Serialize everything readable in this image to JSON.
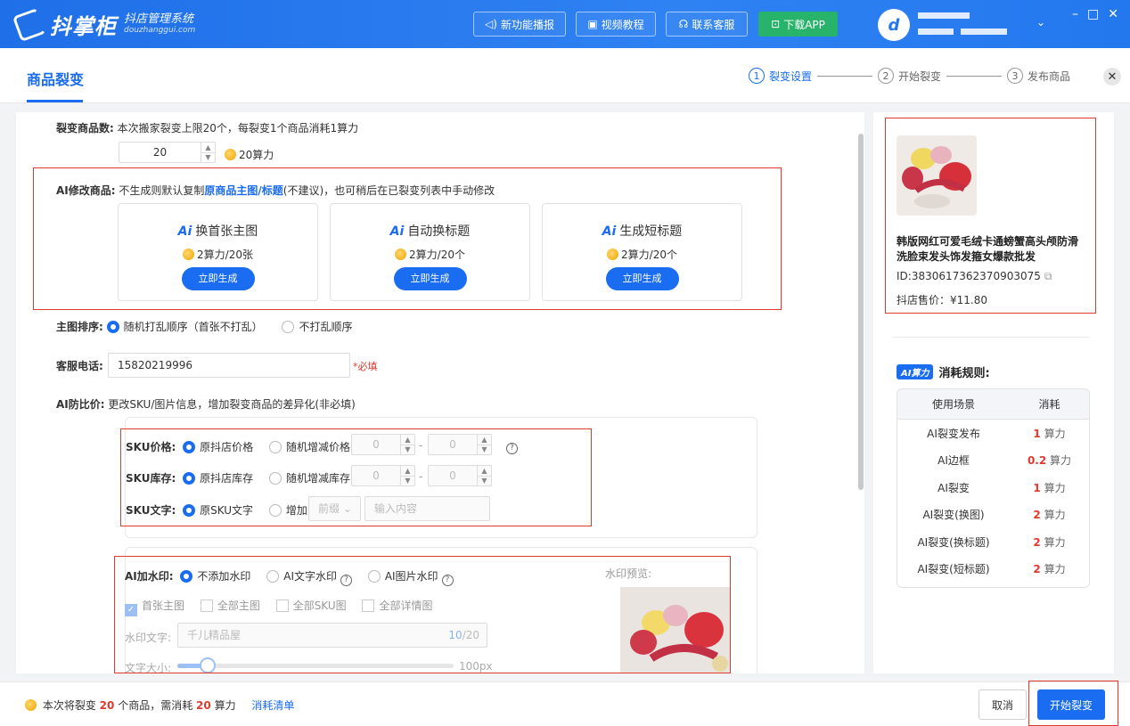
{
  "app": {
    "logo_text": "抖掌柜",
    "logo_sub": "抖店管理系统",
    "logo_domain": "douzhanggui.com",
    "avatar_letter": "d"
  },
  "topbar": {
    "buttons": [
      {
        "label": "新功能播报",
        "icon": "speaker-icon"
      },
      {
        "label": "视频教程",
        "icon": "video-icon"
      },
      {
        "label": "联系客服",
        "icon": "headset-icon"
      },
      {
        "label": "下载APP",
        "icon": "download-icon"
      }
    ],
    "window_controls": [
      "–",
      "□",
      "✕"
    ]
  },
  "header": {
    "title": "商品裂变",
    "steps": [
      {
        "num": "1",
        "label": "裂变设置"
      },
      {
        "num": "2",
        "label": "开始裂变"
      },
      {
        "num": "3",
        "label": "发布商品"
      }
    ],
    "close": "✕"
  },
  "form": {
    "count": {
      "label": "裂变商品数:",
      "desc": "本次搬家裂变上限20个，每裂变1个商品消耗1算力",
      "value": "20",
      "cost": "20算力"
    },
    "ai_modify": {
      "label": "AI修改商品:",
      "desc_pre": "不生成则默认复制",
      "desc_link": "原商品主图/标题",
      "desc_post": "(不建议)，也可稍后在已裂变列表中手动修改",
      "cards": [
        {
          "ai": "Ai",
          "title": "换首张主图",
          "cost": "2算力/20张",
          "button": "立即生成"
        },
        {
          "ai": "Ai",
          "title": "自动换标题",
          "cost": "2算力/20个",
          "button": "立即生成"
        },
        {
          "ai": "Ai",
          "title": "生成短标题",
          "cost": "2算力/20个",
          "button": "立即生成"
        }
      ]
    },
    "sort": {
      "label": "主图排序:",
      "option1": "随机打乱顺序（首张不打乱）",
      "option2": "不打乱顺序"
    },
    "phone": {
      "label": "客服电话:",
      "value": "15820219996",
      "required": "*必填"
    },
    "anti": {
      "label": "AI防比价:",
      "desc": "更改SKU/图片信息，增加裂变商品的差异化(非必填)"
    },
    "sku": {
      "price_label": "SKU价格:",
      "price_opt1": "原抖店价格",
      "price_opt2": "随机增减价格:",
      "stock_label": "SKU库存:",
      "stock_opt1": "原抖店库存",
      "stock_opt2": "随机增减库存:",
      "text_label": "SKU文字:",
      "text_opt1": "原SKU文字",
      "text_opt2": "增加:",
      "text_select": "前缀",
      "text_placeholder": "输入内容",
      "zero": "0",
      "dash": "-",
      "help": "?"
    },
    "watermark": {
      "label": "AI加水印:",
      "opt1": "不添加水印",
      "opt2": "AI文字水印",
      "opt3": "AI图片水印",
      "checks": [
        "首张主图",
        "全部主图",
        "全部SKU图",
        "全部详情图"
      ],
      "text_label": "水印文字:",
      "text_value": "千儿精品屋",
      "text_count": "10",
      "text_max": "/20",
      "size_label": "文字大小:",
      "size_value": "100px",
      "size_fraction": 0.11,
      "preview_label": "水印预览:"
    }
  },
  "product": {
    "title": "韩版网红可爱毛绒卡通螃蟹高头颅防滑洗脸束发头饰发箍女爆款批发",
    "id": "ID:3830617362370903075",
    "price": "抖店售价：¥11.80"
  },
  "rules": {
    "badge": "AI算力",
    "title": "消耗规则:",
    "head": [
      "使用场景",
      "消耗"
    ],
    "unit": "算力",
    "rows": [
      {
        "scene": "AI裂变发布",
        "cost": "1"
      },
      {
        "scene": "AI边框",
        "cost": "0.2"
      },
      {
        "scene": "AI裂变",
        "cost": "1"
      },
      {
        "scene": "AI裂变(换图)",
        "cost": "2"
      },
      {
        "scene": "AI裂变(换标题)",
        "cost": "2"
      },
      {
        "scene": "AI裂变(短标题)",
        "cost": "2"
      }
    ]
  },
  "footer": {
    "pre": "本次将裂变",
    "count": "20",
    "mid": "个商品，需消耗",
    "cost": "20",
    "post": "算力",
    "link": "消耗清单",
    "cancel": "取消",
    "start": "开始裂变"
  },
  "colors": {
    "accent": "#1a6cf0",
    "highlight": "#e03a2f",
    "green": "#27b36a"
  }
}
